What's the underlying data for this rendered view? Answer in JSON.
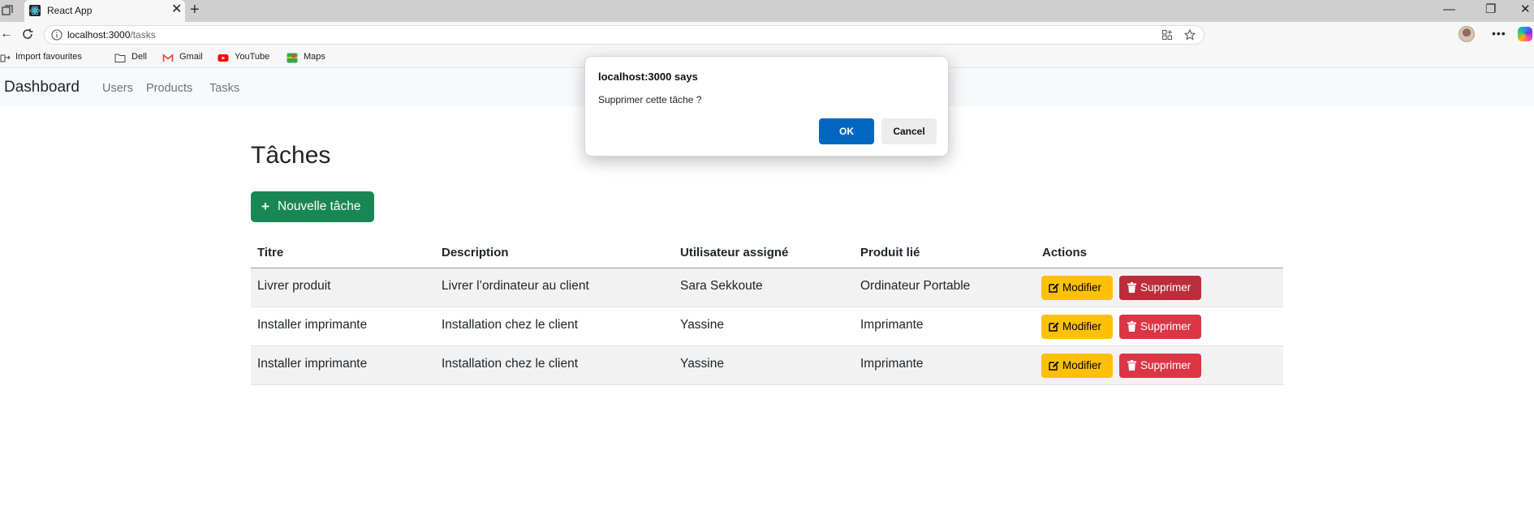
{
  "browser": {
    "tab_title": "React App",
    "url_host": "localhost:3000",
    "url_path": "/tasks",
    "bookmarks": [
      "Import favourites",
      "Dell",
      "Gmail",
      "YouTube",
      "Maps"
    ]
  },
  "navbar": {
    "brand": "Dashboard",
    "links": [
      "Users",
      "Products",
      "Tasks"
    ]
  },
  "page": {
    "title": "Tâches",
    "new_button": "Nouvelle tâche"
  },
  "table": {
    "headers": [
      "Titre",
      "Description",
      "Utilisateur assigné",
      "Produit lié",
      "Actions"
    ],
    "rows": [
      {
        "titre": "Livrer produit",
        "description": "Livrer l’ordinateur au client",
        "utilisateur": "Sara Sekkoute",
        "produit": "Ordinateur Portable"
      },
      {
        "titre": "Installer imprimante",
        "description": "Installation chez le client",
        "utilisateur": "Yassine",
        "produit": "Imprimante"
      },
      {
        "titre": "Installer imprimante",
        "description": "Installation chez le client",
        "utilisateur": "Yassine",
        "produit": "Imprimante"
      }
    ],
    "edit_label": "Modifier",
    "delete_label": "Supprimer"
  },
  "dialog": {
    "title": "localhost:3000 says",
    "message": "Supprimer cette tâche ?",
    "ok": "OK",
    "cancel": "Cancel"
  },
  "colors": {
    "success": "#198754",
    "warning": "#ffc107",
    "danger": "#dc3545",
    "danger_hover": "#bb2d3b",
    "dialog_ok": "#0067c0"
  }
}
